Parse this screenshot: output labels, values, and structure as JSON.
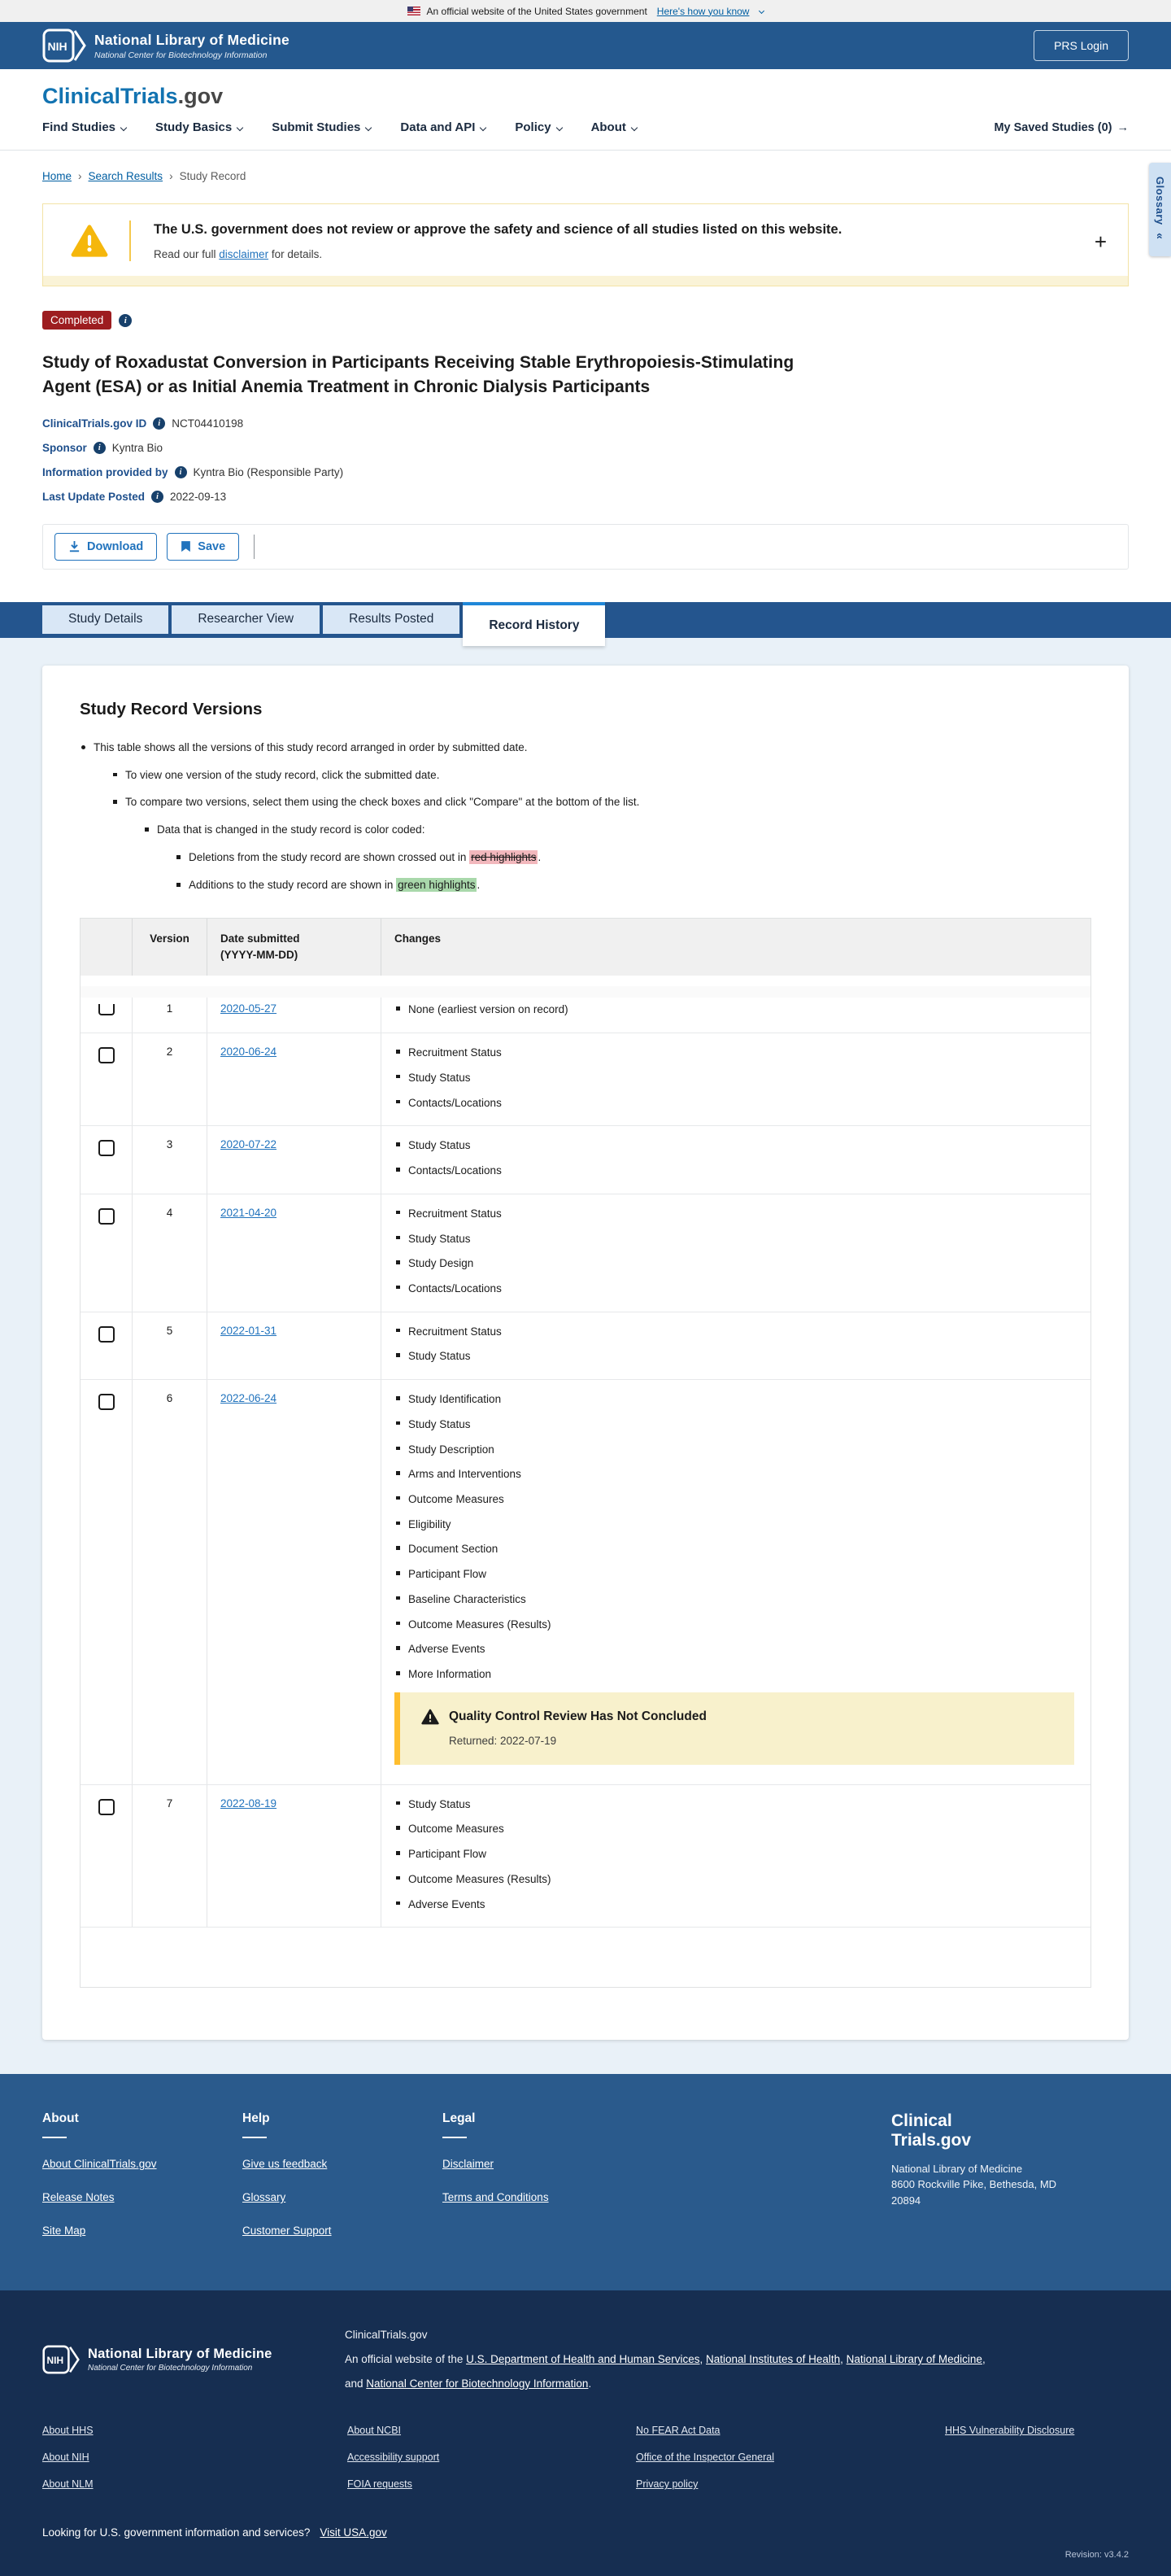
{
  "gov_banner": {
    "text": "An official website of the United States government",
    "link": "Here's how you know"
  },
  "nih_header": {
    "logo": "NIH",
    "org": "National Library of Medicine",
    "suborg": "National Center for Biotechnology Information",
    "prs_login": "PRS Login"
  },
  "site_header": {
    "logo_primary": "ClinicalTrials",
    "logo_secondary": ".gov",
    "nav": [
      {
        "label": "Find Studies"
      },
      {
        "label": "Study Basics"
      },
      {
        "label": "Submit Studies"
      },
      {
        "label": "Data and API"
      },
      {
        "label": "Policy"
      },
      {
        "label": "About"
      }
    ],
    "saved_label": "My Saved Studies (0)",
    "saved_arrow": "→"
  },
  "breadcrumb": {
    "home": "Home",
    "search_results": "Search Results",
    "current": "Study Record",
    "separator": "›"
  },
  "glossary_tab": {
    "label": "Glossary",
    "icon": "«"
  },
  "disclaimer": {
    "heading": "The U.S. government does not review or approve the safety and science of all studies listed on this website.",
    "prefix": "Read our full ",
    "link": "disclaimer",
    "suffix": " for details.",
    "expand": "+"
  },
  "study": {
    "status": "Completed",
    "title": "Study of Roxadustat Conversion in Participants Receiving Stable Erythropoiesis-Stimulating Agent (ESA) or as Initial Anemia Treatment in Chronic Dialysis Participants",
    "info_icon": "i",
    "fields": [
      {
        "label": "ClinicalTrials.gov ID",
        "value": "NCT04410198"
      },
      {
        "label": "Sponsor",
        "value": "Kyntra Bio"
      },
      {
        "label": "Information provided by",
        "value": "Kyntra Bio (Responsible Party)"
      },
      {
        "label": "Last Update Posted",
        "value": "2022-09-13"
      }
    ]
  },
  "toolbar": {
    "download": "Download",
    "save": "Save"
  },
  "tabs": [
    {
      "label": "Study Details"
    },
    {
      "label": "Researcher View"
    },
    {
      "label": "Results Posted"
    },
    {
      "label": "Record History"
    }
  ],
  "record_history": {
    "heading": "Study Record Versions",
    "intro": {
      "l1": "This table shows all the versions of this study record arranged in order by submitted date.",
      "l2a": "To view one version of the study record, click the submitted date.",
      "l2b": "To compare two versions, select them using the check boxes and click \"Compare\" at the bottom of the list.",
      "l3": "Data that is changed in the study record is color coded:",
      "l4a_prefix": "Deletions from the study record are shown crossed out in ",
      "l4a_highlight": "red highlights",
      "l4a_suffix": ".",
      "l4b_prefix": "Additions to the study record are shown in ",
      "l4b_highlight": "green highlights",
      "l4b_suffix": "."
    },
    "table": {
      "col_version": "Version",
      "col_date_line1": "Date submitted",
      "col_date_line2": "(YYYY-MM-DD)",
      "col_changes": "Changes",
      "rows": [
        {
          "version": "1",
          "date": "2020-05-27",
          "changes": [
            "None (earliest version on record)"
          ]
        },
        {
          "version": "2",
          "date": "2020-06-24",
          "changes": [
            "Recruitment Status",
            "Study Status",
            "Contacts/Locations"
          ]
        },
        {
          "version": "3",
          "date": "2020-07-22",
          "changes": [
            "Study Status",
            "Contacts/Locations"
          ]
        },
        {
          "version": "4",
          "date": "2021-04-20",
          "changes": [
            "Recruitment Status",
            "Study Status",
            "Study Design",
            "Contacts/Locations"
          ]
        },
        {
          "version": "5",
          "date": "2022-01-31",
          "changes": [
            "Recruitment Status",
            "Study Status"
          ]
        },
        {
          "version": "6",
          "date": "2022-06-24",
          "changes": [
            "Study Identification",
            "Study Status",
            "Study Description",
            "Arms and Interventions",
            "Outcome Measures",
            "Eligibility",
            "Document Section",
            "Participant Flow",
            "Baseline Characteristics",
            "Outcome Measures (Results)",
            "Adverse Events",
            "More Information"
          ],
          "notice": {
            "title": "Quality Control Review Has Not Concluded",
            "detail": "Returned: 2022-07-19"
          }
        },
        {
          "version": "7",
          "date": "2022-08-19",
          "changes": [
            "Study Status",
            "Outcome Measures",
            "Participant Flow",
            "Outcome Measures (Results)",
            "Adverse Events"
          ]
        }
      ]
    }
  },
  "footer": {
    "about": {
      "heading": "About",
      "links": [
        "About ClinicalTrials.gov",
        "Release Notes",
        "Site Map"
      ]
    },
    "help": {
      "heading": "Help",
      "links": [
        "Give us feedback",
        "Glossary",
        "Customer Support"
      ]
    },
    "legal": {
      "heading": "Legal",
      "links": [
        "Disclaimer",
        "Terms and Conditions"
      ]
    },
    "brand": {
      "line1": "Clinical",
      "line2": "Trials.gov",
      "org": "National Library of Medicine",
      "address1": "8600 Rockville Pike, Bethesda, MD",
      "address2": "20894"
    }
  },
  "subfooter": {
    "nlm_logo": "NIH",
    "org": "National Library of Medicine",
    "suborg": "National Center for Biotechnology Information",
    "site_name": "ClinicalTrials.gov",
    "official_prefix": "An official website of the ",
    "link_hhs": "U.S. Department of Health and Human Services",
    "sep1": ", ",
    "link_nih": "National Institutes of Health",
    "sep2": ", ",
    "link_nlm": "National Library of Medicine",
    "sep3": ", and ",
    "link_ncbi": "National Center for Biotechnology Information",
    "period": ".",
    "grid": {
      "col1": [
        "About HHS",
        "About NIH",
        "About NLM"
      ],
      "col2": [
        "About NCBI",
        "Accessibility support",
        "FOIA requests"
      ],
      "col3": [
        "No FEAR Act Data",
        "Office of the Inspector General",
        "Privacy policy"
      ],
      "col4": [
        "HHS Vulnerability Disclosure"
      ]
    },
    "usa_text": "Looking for U.S. government information and services?",
    "usa_link": "Visit USA.gov",
    "revision": "Revision: v3.4.2"
  }
}
